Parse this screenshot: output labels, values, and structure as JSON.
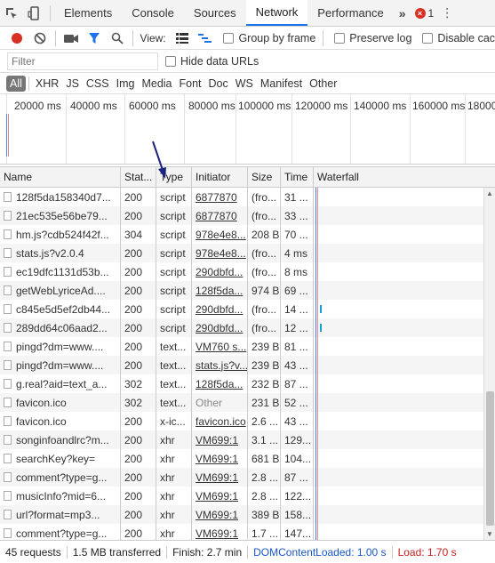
{
  "tabbar": {
    "tabs": [
      "Elements",
      "Console",
      "Sources",
      "Network",
      "Performance"
    ],
    "active_tab": "Network",
    "more": "»",
    "error_count": "1"
  },
  "toolbar": {
    "view_label": "View:",
    "group_by_frame": "Group by frame",
    "preserve_log": "Preserve log",
    "disable_cache": "Disable cac"
  },
  "filterbar": {
    "placeholder": "Filter",
    "hide_data_urls": "Hide data URLs"
  },
  "types": [
    "All",
    "XHR",
    "JS",
    "CSS",
    "Img",
    "Media",
    "Font",
    "Doc",
    "WS",
    "Manifest",
    "Other"
  ],
  "overview": {
    "ticks": [
      "20000 ms",
      "40000 ms",
      "60000 ms",
      "80000 ms",
      "100000 ms",
      "120000 ms",
      "140000 ms",
      "160000 ms",
      "18000"
    ]
  },
  "table": {
    "headers": {
      "name": "Name",
      "status": "Stat...",
      "type": "Type",
      "initiator": "Initiator",
      "size": "Size",
      "time": "Time",
      "waterfall": "Waterfall"
    },
    "rows": [
      {
        "name": "128f5da158340d7...",
        "status": "200",
        "type": "script",
        "initiator": "6877870",
        "initiator_link": true,
        "size": "(fro...",
        "size_muted": true,
        "time": "31 ...",
        "wf": false
      },
      {
        "name": "21ec535e56be79...",
        "status": "200",
        "type": "script",
        "initiator": "6877870",
        "initiator_link": true,
        "size": "(fro...",
        "size_muted": true,
        "time": "33 ...",
        "wf": false
      },
      {
        "name": "hm.js?cdb524f42f...",
        "status": "304",
        "type": "script",
        "initiator": "978e4e8...",
        "initiator_link": true,
        "size": "208 B",
        "size_muted": false,
        "time": "70 ...",
        "wf": false
      },
      {
        "name": "stats.js?v2.0.4",
        "status": "200",
        "type": "script",
        "initiator": "978e4e8...",
        "initiator_link": true,
        "size": "(fro...",
        "size_muted": true,
        "time": "4 ms",
        "wf": false
      },
      {
        "name": "ec19dfc1131d53b...",
        "status": "200",
        "type": "script",
        "initiator": "290dbfd...",
        "initiator_link": true,
        "size": "(fro...",
        "size_muted": true,
        "time": "8 ms",
        "wf": false
      },
      {
        "name": "getWebLyriceAd....",
        "status": "200",
        "type": "script",
        "initiator": "128f5da...",
        "initiator_link": true,
        "size": "974 B",
        "size_muted": false,
        "time": "69 ...",
        "wf": false
      },
      {
        "name": "c845e5d5ef2db44...",
        "status": "200",
        "type": "script",
        "initiator": "290dbfd...",
        "initiator_link": true,
        "size": "(fro...",
        "size_muted": true,
        "time": "14 ...",
        "wf": true
      },
      {
        "name": "289dd64c06aad2...",
        "status": "200",
        "type": "script",
        "initiator": "290dbfd...",
        "initiator_link": true,
        "size": "(fro...",
        "size_muted": true,
        "time": "12 ...",
        "wf": true
      },
      {
        "name": "pingd?dm=www....",
        "status": "200",
        "type": "text...",
        "initiator": "VM760 s...",
        "initiator_link": true,
        "size": "239 B",
        "size_muted": false,
        "time": "81 ...",
        "wf": false
      },
      {
        "name": "pingd?dm=www....",
        "status": "200",
        "type": "text...",
        "initiator": "stats.js?v...",
        "initiator_link": true,
        "size": "239 B",
        "size_muted": false,
        "time": "43 ...",
        "wf": false
      },
      {
        "name": "g.real?aid=text_a...",
        "status": "302",
        "type": "text...",
        "initiator": "128f5da...",
        "initiator_link": true,
        "size": "232 B",
        "size_muted": false,
        "time": "87 ...",
        "wf": false
      },
      {
        "name": "favicon.ico",
        "status": "302",
        "type": "text...",
        "initiator": "Other",
        "initiator_link": false,
        "size": "231 B",
        "size_muted": false,
        "time": "52 ...",
        "wf": false
      },
      {
        "name": "favicon.ico",
        "status": "200",
        "type": "x-ic...",
        "initiator": "favicon.ico",
        "initiator_link": true,
        "size": "2.6 ...",
        "size_muted": false,
        "time": "43 ...",
        "wf": false
      },
      {
        "name": "songinfoandlrc?m...",
        "status": "200",
        "type": "xhr",
        "initiator": "VM699:1",
        "initiator_link": true,
        "size": "3.1 ...",
        "size_muted": false,
        "time": "129...",
        "wf": false
      },
      {
        "name": "searchKey?key=",
        "status": "200",
        "type": "xhr",
        "initiator": "VM699:1",
        "initiator_link": true,
        "size": "681 B",
        "size_muted": false,
        "time": "104...",
        "wf": false
      },
      {
        "name": "comment?type=g...",
        "status": "200",
        "type": "xhr",
        "initiator": "VM699:1",
        "initiator_link": true,
        "size": "2.8 ...",
        "size_muted": false,
        "time": "87 ...",
        "wf": false
      },
      {
        "name": "musicInfo?mid=6...",
        "status": "200",
        "type": "xhr",
        "initiator": "VM699:1",
        "initiator_link": true,
        "size": "2.8 ...",
        "size_muted": false,
        "time": "122...",
        "wf": false
      },
      {
        "name": "url?format=mp3...",
        "status": "200",
        "type": "xhr",
        "initiator": "VM699:1",
        "initiator_link": true,
        "size": "389 B",
        "size_muted": false,
        "time": "158...",
        "wf": false
      },
      {
        "name": "comment?type=g...",
        "status": "200",
        "type": "xhr",
        "initiator": "VM699:1",
        "initiator_link": true,
        "size": "1.7 ...",
        "size_muted": false,
        "time": "147...",
        "wf": false
      }
    ]
  },
  "statusbar": {
    "requests": "45 requests",
    "transferred": "1.5 MB transferred",
    "finish": "Finish: 2.7 min",
    "dom_content_loaded": "DOMContentLoaded: 1.00 s",
    "load": "Load: 1.70 s"
  },
  "colors": {
    "record": "#d93025",
    "filter_active": "#1a73e8",
    "dcl": "#1a56c7",
    "load": "#c5221f",
    "annotation_arrow": "#1a237e"
  }
}
